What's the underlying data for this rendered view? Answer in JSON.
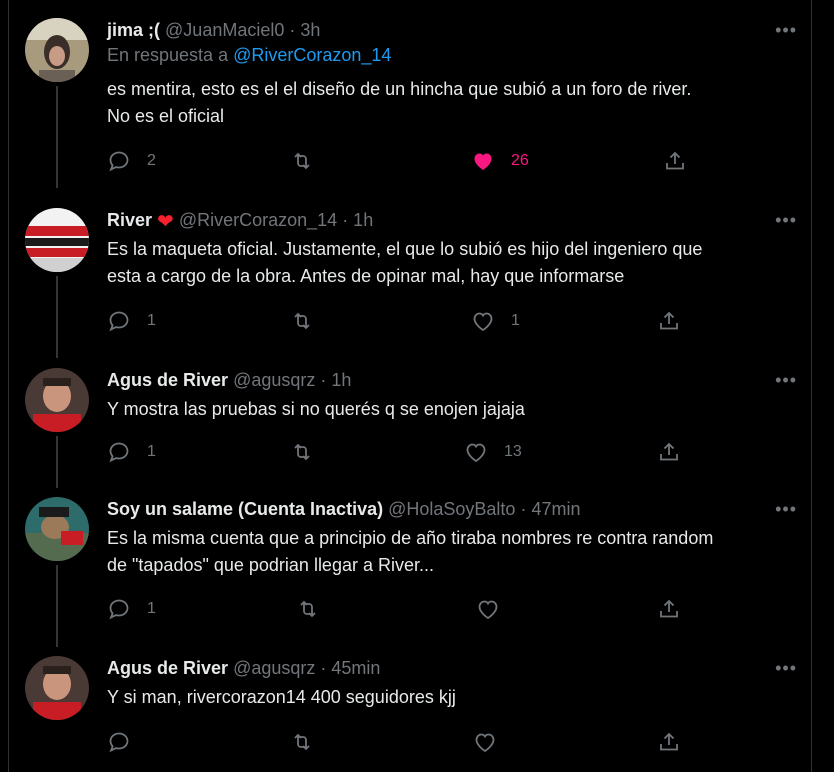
{
  "colors": {
    "background": "#000000",
    "text": "#e7e9ea",
    "secondary": "#71767b",
    "link": "#1d9bf0",
    "like": "#f91880",
    "thread": "#333639"
  },
  "tweets": [
    {
      "name": "jima ;(",
      "handle": "@JuanMaciel0",
      "time": "· 3h",
      "reply_prefix": "En respuesta a",
      "reply_handle": "@RiverCorazon_14",
      "text_lines": [
        "es mentira, esto es el el diseño de un hincha que subió a un foro de river.",
        "No es el oficial"
      ],
      "replies": "2",
      "retweets": "",
      "likes": "26",
      "liked": true
    },
    {
      "name": "River",
      "name_emoji": "❤",
      "handle": "@RiverCorazon_14",
      "time": "· 1h",
      "text_lines": [
        "Es la maqueta oficial. Justamente, el que lo subió es hijo del ingeniero que",
        "esta a cargo de la obra. Antes de opinar mal, hay que informarse"
      ],
      "replies": "1",
      "retweets": "",
      "likes": "1",
      "liked": false
    },
    {
      "name": "Agus de River",
      "handle": "@agusqrz",
      "time": "· 1h",
      "text_lines": [
        "Y mostra las pruebas si no querés q se enojen jajaja"
      ],
      "replies": "1",
      "retweets": "",
      "likes": "13",
      "liked": false
    },
    {
      "name": "Soy un salame (Cuenta Inactiva)",
      "handle": "@HolaSoyBalto",
      "time": "· 47min",
      "text_lines": [
        "Es la misma cuenta que a principio de año tiraba nombres re contra random",
        "de \"tapados\" que podrian llegar a River..."
      ],
      "replies": "1",
      "retweets": "",
      "likes": "",
      "liked": false
    },
    {
      "name": "Agus de River",
      "handle": "@agusqrz",
      "time": "· 45min",
      "text_lines": [
        "Y si man, rivercorazon14 400 seguidores kjj"
      ],
      "replies": "",
      "retweets": "",
      "likes": "",
      "liked": false
    }
  ],
  "icons": {
    "more": "more-dots-icon",
    "reply": "reply-icon",
    "retweet": "retweet-icon",
    "like": "heart-icon",
    "share": "share-icon"
  }
}
